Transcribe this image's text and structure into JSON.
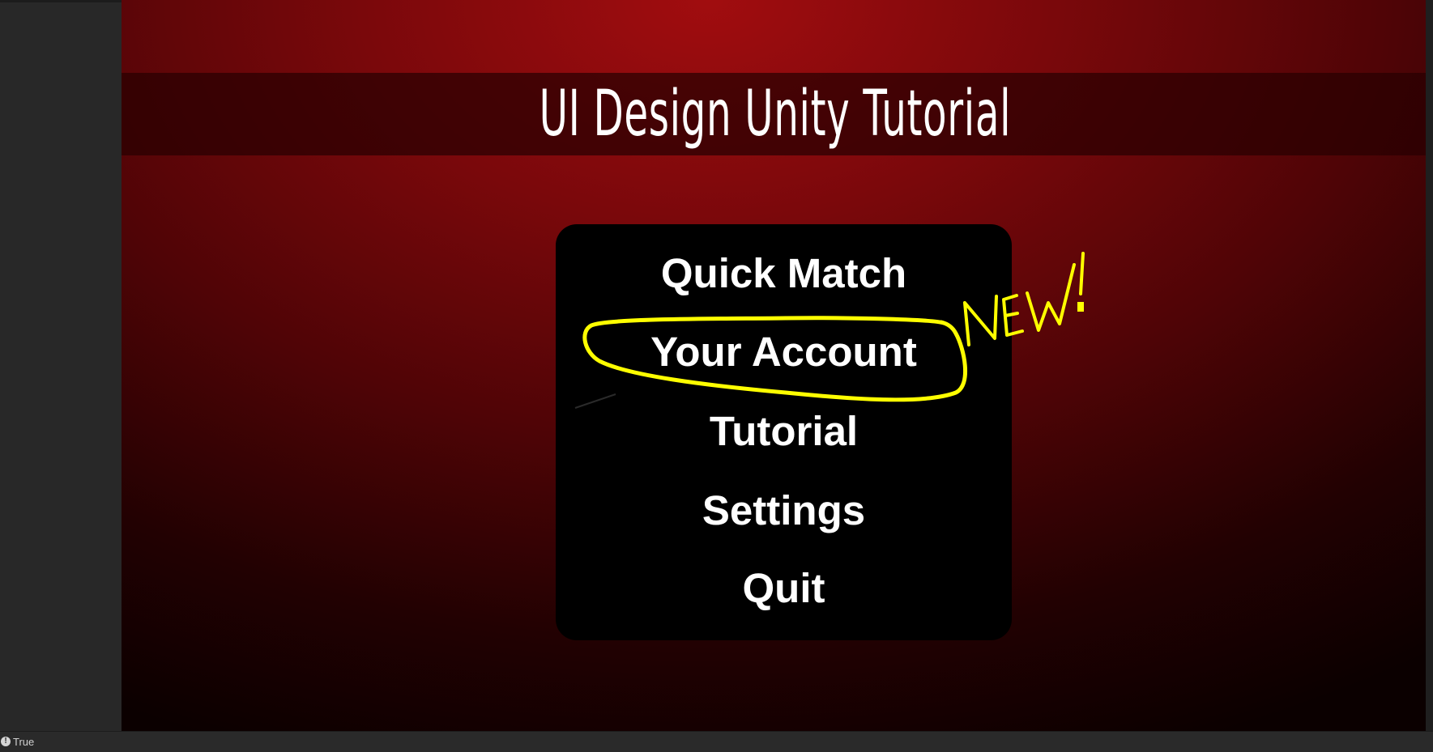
{
  "title": "UI Design Unity Tutorial",
  "menu": {
    "items": [
      {
        "label": "Quick Match"
      },
      {
        "label": "Your Account"
      },
      {
        "label": "Tutorial"
      },
      {
        "label": "Settings"
      },
      {
        "label": "Quit"
      }
    ]
  },
  "annotation": {
    "text": "NEW!",
    "color": "#ffff00",
    "highlighted_item": "Your Account"
  },
  "status_bar": {
    "icon": "info-icon",
    "text": "True"
  },
  "colors": {
    "background_top": "#a10d0f",
    "background_bottom": "#0b0000",
    "panel": "#000000",
    "text": "#ffffff"
  }
}
